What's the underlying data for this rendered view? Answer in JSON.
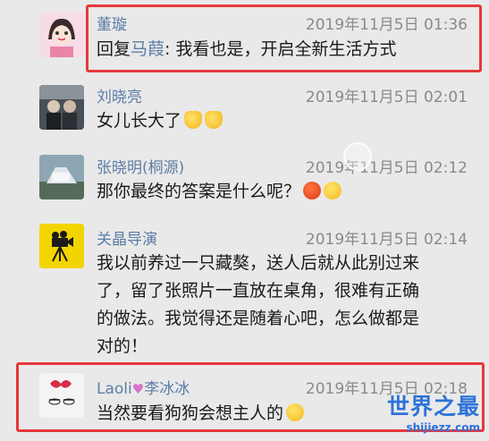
{
  "comments": [
    {
      "name": "董璇",
      "time": "2019年11月5日 01:36",
      "reply_prefix": "回复",
      "reply_target": "马葭",
      "reply_text": ": 我看也是，开启全新生活方式"
    },
    {
      "name": "刘晓亮",
      "time": "2019年11月5日 02:01",
      "text": "女儿长大了"
    },
    {
      "name": "张晓明(桐源)",
      "time": "2019年11月5日 02:12",
      "text": "那你最终的答案是什么呢？"
    },
    {
      "name": "关晶导演",
      "time": "2019年11月5日 02:14",
      "lines": [
        "我以前养过一只藏獒，送人后就从此别过来",
        "了，留了张照片一直放在桌角，很难有正确",
        "的做法。我觉得还是随着心吧，怎么做都是",
        "对的！"
      ]
    },
    {
      "name_part1": "Laoli",
      "name_part2": "李冰冰",
      "time": "2019年11月5日 02:18",
      "text": "当然要看狗狗会想主人的"
    }
  ],
  "watermark": {
    "main": "世界之最",
    "url": "shijiezz.com"
  },
  "colors": {
    "highlight": "#e5383b",
    "name": "#5d7da6"
  }
}
